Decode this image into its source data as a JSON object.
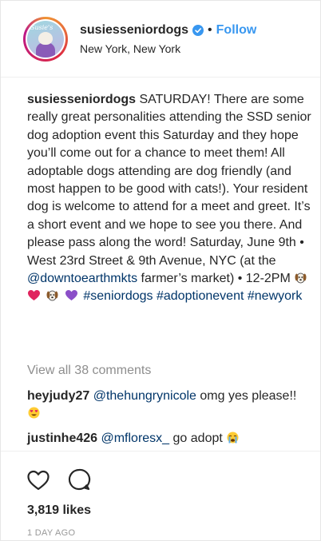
{
  "header": {
    "avatar_text": "Susie's",
    "username": "susiesseniordogs",
    "dot": "•",
    "follow_label": "Follow",
    "location": "New York, New York"
  },
  "caption": {
    "username": "susiesseniordogs",
    "body": "SATURDAY! There are some really great personalities attending the SSD senior dog adoption event this Saturday and they hope you’ll come out for a chance to meet them! All adoptable dogs attending are dog friendly (and most happen to be good with cats!). Your resident dog is welcome to attend for a meet and greet. It’s a short event and we hope to see you there. And please pass along the word! Saturday, June 9th • West 23rd Street & 9th Avenue, NYC (at the",
    "mention": "@downtoearthmkts",
    "after_mention": " farmer’s market) • 12-2PM",
    "emojis": [
      "dog-face-icon",
      "heart-icon",
      "dog-face-icon",
      "purple-heart-icon"
    ],
    "hashtags": [
      "#seniordogs",
      "#adoptionevent",
      "#newyork"
    ]
  },
  "comments": {
    "view_all": "View all 38 comments",
    "items": [
      {
        "user": "heyjudy27",
        "mention": "@thehungrynicole",
        "text": " omg yes please!!",
        "emoji": "heart-eyes-face-icon"
      },
      {
        "user": "justinhe426",
        "mention": "@mfloresx_",
        "text": " go adopt",
        "emoji": "crying-face-icon"
      }
    ]
  },
  "actions": {
    "like_icon": "heart-outline-icon",
    "comment_icon": "comment-bubble-icon",
    "likes": "3,819 likes",
    "time": "1 DAY AGO"
  },
  "colors": {
    "link": "#003569",
    "follow": "#3897f0",
    "muted": "#8e8e8e"
  }
}
